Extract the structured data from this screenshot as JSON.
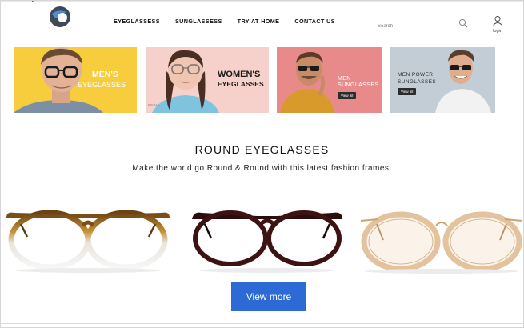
{
  "header": {
    "close_glyph": "x",
    "nav": [
      "EYEGLASSESS",
      "SUNGLASSESS",
      "TRY AT HOME",
      "CONTACT US"
    ],
    "search_placeholder": "Search",
    "login_label": "login"
  },
  "banners": [
    {
      "title_line1": "MEN'S",
      "title_line2": "EYEGLASSES",
      "bg": "#f7cd3d"
    },
    {
      "title_line1": "WOMEN'S",
      "title_line2": "EYEGLASSES",
      "tag": "FZ1016",
      "bg": "#f6d1cb"
    },
    {
      "title_line1": "MEN",
      "title_line2": "SUNGLASSES",
      "button": "View all",
      "bg": "#e8898a"
    },
    {
      "title_line1": "MEN POWER",
      "title_line2": "SUNGLASSES",
      "button": "View all",
      "bg": "#c3cdd6"
    }
  ],
  "section": {
    "title": "ROUND EYEGLASSES",
    "subtitle": "Make the world go Round & Round with this latest fashion frames."
  },
  "products": [
    {
      "name_icon": "tortoise-round-glasses-icon"
    },
    {
      "name_icon": "burgundy-round-glasses-icon"
    },
    {
      "name_icon": "gold-clear-round-glasses-icon"
    }
  ],
  "cta": {
    "view_more": "View more",
    "color": "#2d6ad6"
  }
}
